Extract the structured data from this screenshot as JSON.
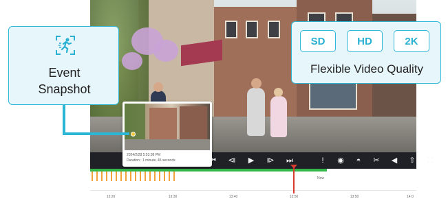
{
  "event_callout": {
    "icon": "running-person-icon",
    "label_line1": "Event",
    "label_line2": "Snapshot"
  },
  "quality_callout": {
    "options": [
      "SD",
      "HD",
      "2K"
    ],
    "label": "Flexible Video Quality"
  },
  "thumbnail": {
    "timestamp": "2024/2/28 5:53:38 PM",
    "duration": "Duration : 1 minute, 45 seconds"
  },
  "controls": {
    "left": [
      {
        "icon": "skip-back-icon",
        "glyph": "⏮"
      },
      {
        "icon": "frame-back-icon",
        "glyph": "⧏"
      },
      {
        "icon": "play-icon",
        "glyph": "▶"
      },
      {
        "icon": "frame-forward-icon",
        "glyph": "⧐"
      },
      {
        "icon": "skip-forward-icon",
        "glyph": "⏭"
      }
    ],
    "right": [
      {
        "icon": "alert-icon",
        "glyph": "!"
      },
      {
        "icon": "camera-snapshot-icon",
        "glyph": "◉"
      },
      {
        "icon": "mask-icon",
        "glyph": "◓"
      },
      {
        "icon": "scissors-icon",
        "glyph": "✂"
      },
      {
        "icon": "volume-icon",
        "glyph": "◀"
      },
      {
        "icon": "share-upload-icon",
        "glyph": "⇧"
      },
      {
        "icon": "fullscreen-icon",
        "glyph": "⛶"
      }
    ]
  },
  "timeline": {
    "now_label": "Now",
    "labels": [
      "13:20",
      "13:30",
      "13:40",
      "13:50",
      "13:50",
      "14:0"
    ],
    "accent_green": "#35b64a",
    "accent_orange": "#f2a33c",
    "now_color": "#d83a2f"
  }
}
